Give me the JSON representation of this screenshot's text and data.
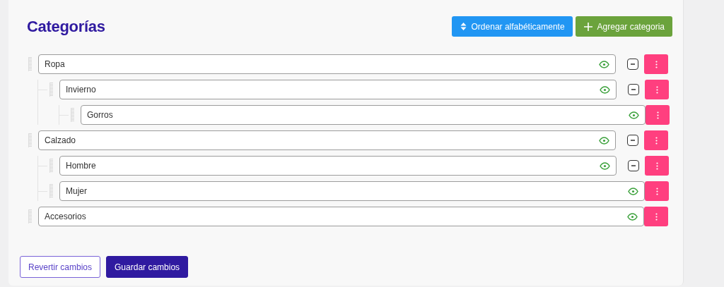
{
  "title": "Categorías",
  "actions": [
    {
      "kind": "sort",
      "label": "Ordenar alfabéticamente"
    },
    {
      "kind": "add",
      "label": "Agregar categoria"
    }
  ],
  "categories": [
    {
      "name": "Ropa",
      "visible": true,
      "expanded": true,
      "children": [
        {
          "name": "Invierno",
          "visible": true,
          "expanded": true,
          "children": [
            {
              "name": "Gorros",
              "visible": true
            }
          ]
        }
      ]
    },
    {
      "name": "Calzado",
      "visible": true,
      "expanded": true,
      "children": [
        {
          "name": "Hombre",
          "visible": true,
          "expanded": true
        },
        {
          "name": "Mujer",
          "visible": true
        }
      ]
    },
    {
      "name": "Accesorios",
      "visible": true
    }
  ],
  "footer": [
    {
      "kind": "outline",
      "label": "Revertir cambios"
    },
    {
      "kind": "primary",
      "label": "Guardar cambios"
    }
  ]
}
